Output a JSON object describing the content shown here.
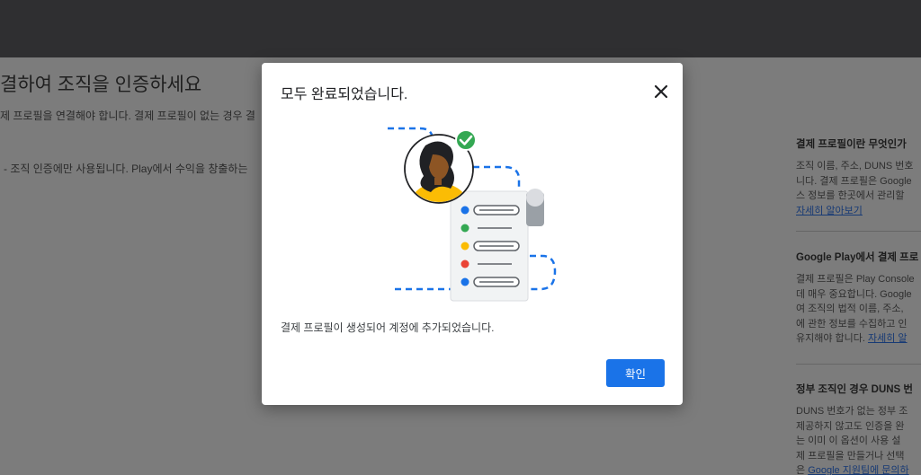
{
  "page": {
    "title": "결하여 조직을 인증하세요",
    "description": "제 프로필을 연결해야 합니다. 결제 프로필이 없는 경우 결",
    "note": "- 조직 인증에만 사용됩니다. Play에서 수익을 창출하는"
  },
  "sidebar": {
    "sections": [
      {
        "heading": "결제 프로필이란 무엇인가",
        "lines": [
          "조직 이름, 주소, DUNS 번호",
          "니다. 결제 프로필은 Google",
          "스 정보를 한곳에서 관리할"
        ],
        "link": "자세히 알아보기"
      },
      {
        "heading": "Google Play에서 결제 프로",
        "lines": [
          "결제 프로필은 Play Console",
          "데 매우 중요합니다. Google",
          "여 조직의 법적 이름, 주소,",
          "에 관한 정보를 수집하고 인"
        ],
        "last_line": "유지해야 합니다.",
        "link": "자세히 알"
      },
      {
        "heading": "정부 조직인 경우 DUNS 번",
        "lines": [
          "DUNS 번호가 없는 정부 조",
          "제공하지 않고도 인증을 완",
          "는 이미 이 옵션이 사용 설",
          "제 프로필을 만들거나 선택"
        ],
        "last_prefix": "은",
        "link": "Google 지원팀에 문의하"
      }
    ]
  },
  "modal": {
    "title": "모두 완료되었습니다.",
    "message": "결제 프로필이 생성되어 계정에 추가되었습니다.",
    "ok_label": "확인"
  },
  "icons": {
    "close": "close-icon",
    "check": "check-icon"
  },
  "colors": {
    "accent": "#1a73e8",
    "success": "#34a853",
    "warning": "#fbbc04",
    "error": "#ea4335"
  }
}
